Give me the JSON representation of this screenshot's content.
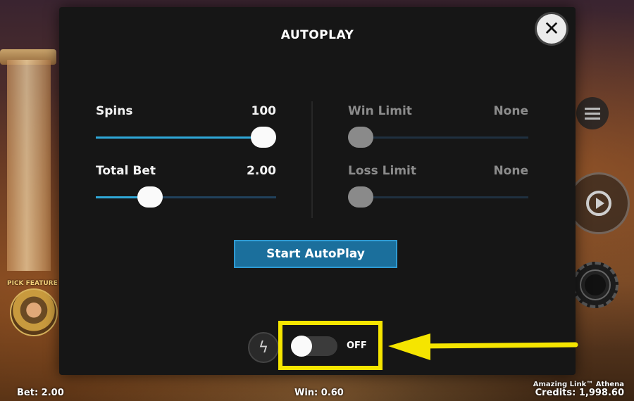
{
  "modal": {
    "title": "AUTOPLAY",
    "close_icon": "close-icon",
    "left_sliders": [
      {
        "label": "Spins",
        "value": "100",
        "fraction": 1.0
      },
      {
        "label": "Total Bet",
        "value": "2.00",
        "fraction": 0.3
      }
    ],
    "right_sliders": [
      {
        "label": "Win Limit",
        "value": "None",
        "fraction": 0.0,
        "disabled": true
      },
      {
        "label": "Loss Limit",
        "value": "None",
        "fraction": 0.0,
        "disabled": true
      }
    ],
    "start_button": "Start AutoPlay",
    "turbo_icon": "lightning-icon",
    "toggle": {
      "state": "OFF",
      "on": false
    }
  },
  "background": {
    "pick_feature_label": "PICK FEATURE"
  },
  "footer": {
    "bet": "Bet: 2.00",
    "win": "Win: 0.60",
    "game_title": "Amazing Link™ Athena",
    "credits": "Credits: 1,998.60"
  },
  "colors": {
    "accent": "#2fa8d8",
    "highlight": "#f5e500",
    "button": "#1b6f9c"
  }
}
